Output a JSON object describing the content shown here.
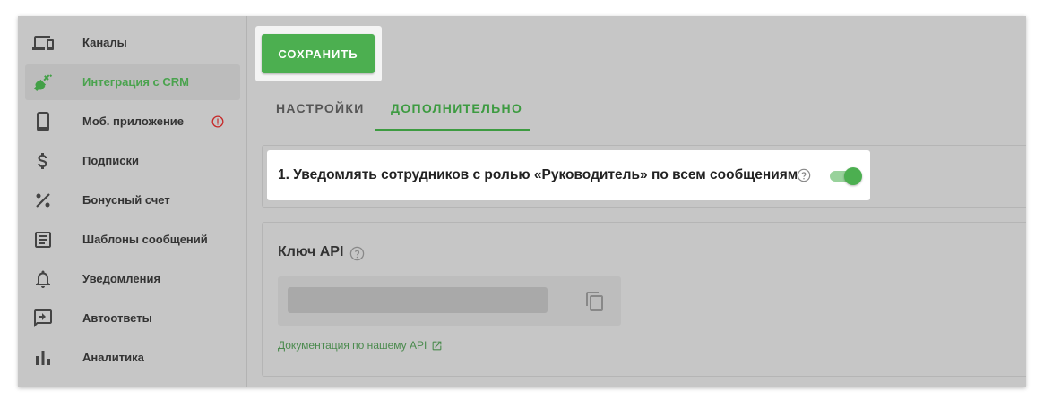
{
  "sidebar": {
    "items": [
      {
        "label": "Каналы",
        "icon": "devices-icon"
      },
      {
        "label": "Интеграция с CRM",
        "icon": "plug-icon"
      },
      {
        "label": "Моб. приложение",
        "icon": "phone-icon"
      },
      {
        "label": "Подписки",
        "icon": "dollar-icon"
      },
      {
        "label": "Бонусный счет",
        "icon": "percent-icon"
      },
      {
        "label": "Шаблоны сообщений",
        "icon": "document-icon"
      },
      {
        "label": "Уведомления",
        "icon": "bell-icon"
      },
      {
        "label": "Автоответы",
        "icon": "reply-icon"
      },
      {
        "label": "Аналитика",
        "icon": "bar-chart-icon"
      }
    ],
    "active_index": 1
  },
  "toolbar": {
    "save_label": "СОХРАНИТЬ"
  },
  "tabs": [
    {
      "label": "НАСТРОЙКИ",
      "active": false
    },
    {
      "label": "ДОПОЛНИТЕЛЬНО",
      "active": true
    }
  ],
  "notifications": {
    "text": "1. Уведомлять сотрудников с ролью «Руководитель» по всем сообщениям",
    "enabled": true
  },
  "api": {
    "title": "Ключ API",
    "doc_link": "Документация по нашему API"
  },
  "colors": {
    "accent": "#4caf50",
    "active_text": "#4aa34e",
    "warning": "#c62828"
  }
}
